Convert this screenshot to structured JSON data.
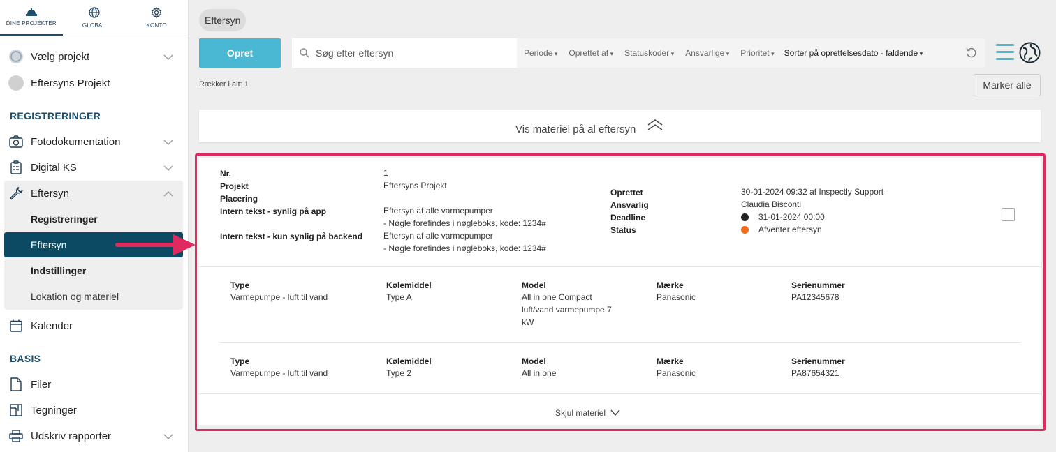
{
  "topnav": {
    "projects": "DINE PROJEKTER",
    "global": "GLOBAL",
    "account": "KONTO"
  },
  "sidebar": {
    "select_project": "Vælg projekt",
    "project_name": "Eftersyns Projekt",
    "section_registrations": "REGISTRERINGER",
    "photo": "Fotodokumentation",
    "digital_ks": "Digital KS",
    "inspection": "Eftersyn",
    "sub_registrations": "Registreringer",
    "sub_inspection": "Eftersyn",
    "sub_settings": "Indstillinger",
    "sub_location": "Lokation og materiel",
    "calendar": "Kalender",
    "section_basis": "BASIS",
    "files": "Filer",
    "drawings": "Tegninger",
    "print_reports": "Udskriv rapporter"
  },
  "header": {
    "chip": "Eftersyn",
    "create": "Opret",
    "search_placeholder": "Søg efter eftersyn",
    "filters": [
      "Periode",
      "Oprettet af",
      "Statuskoder",
      "Ansvarlige",
      "Prioritet"
    ],
    "sort": "Sorter på oprettelsesdato - faldende",
    "rows_total": "Rækker i alt: 1",
    "mark_all": "Marker alle"
  },
  "show_material": "Vis materiel på al eftersyn",
  "record": {
    "labels": {
      "nr": "Nr.",
      "project": "Projekt",
      "placement": "Placering",
      "internal_app": "Intern tekst - synlig på app",
      "internal_backend": "Intern tekst - kun synlig på backend",
      "created": "Oprettet",
      "responsible": "Ansvarlig",
      "deadline": "Deadline",
      "status": "Status"
    },
    "nr": "1",
    "project": "Eftersyns Projekt",
    "internal_app_1": "Eftersyn af alle varmepumper",
    "internal_app_2": "- Nøgle forefindes i nøgleboks, kode: 1234#",
    "internal_backend_1": "Eftersyn af alle varmepumper",
    "internal_backend_2": "- Nøgle forefindes i nøgleboks, kode: 1234#",
    "created": "30-01-2024 09:32 af Inspectly Support",
    "responsible": "Claudia Bisconti",
    "deadline": "31-01-2024 00:00",
    "status": "Afventer eftersyn",
    "colors": {
      "deadline_dot": "#222222",
      "status_dot": "#f26a1b"
    }
  },
  "material": {
    "headers": {
      "type": "Type",
      "coolant": "Kølemiddel",
      "model": "Model",
      "brand": "Mærke",
      "serial": "Serienummer"
    },
    "items": [
      {
        "type": "Varmepumpe - luft til vand",
        "coolant": "Type A",
        "model_1": "All in one Compact",
        "model_2": "luft/vand varmepumpe 7",
        "model_3": "kW",
        "brand": "Panasonic",
        "serial": "PA12345678"
      },
      {
        "type": "Varmepumpe - luft til vand",
        "coolant": "Type 2",
        "model_1": "All in one",
        "brand": "Panasonic",
        "serial": "PA87654321"
      }
    ]
  },
  "hide_material": "Skjul materiel",
  "colors": {
    "primary": "#0c4a63",
    "accent": "#4bb8d3",
    "highlight": "#e02a5f"
  }
}
